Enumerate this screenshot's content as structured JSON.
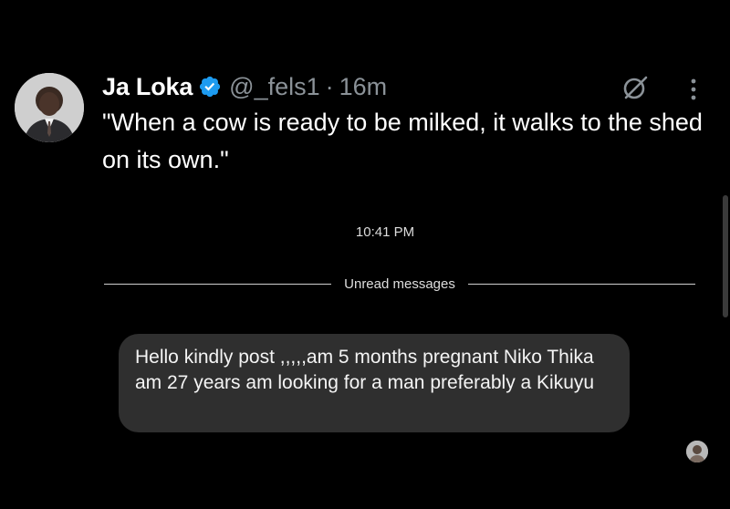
{
  "tweet": {
    "author_name": "Ja Loka",
    "handle": "@_fels1",
    "separator": "·",
    "time_ago": "16m",
    "text": "\"When a cow is ready to be milked, it walks to the shed on its own.\"",
    "icons": {
      "verified": "verified-badge-icon",
      "grok": "grok-icon",
      "more": "more-options-icon"
    },
    "colors": {
      "verified": "#1d9bf0",
      "handle": "#8b9298"
    }
  },
  "chat": {
    "timestamp": "10:41 PM",
    "unread_label": "Unread messages",
    "message": "Hello kindly post ,,,,,am 5 months pregnant Niko Thika am 27 years am looking for a man preferably a Kikuyu",
    "bubble_color": "#2f2f2f"
  }
}
